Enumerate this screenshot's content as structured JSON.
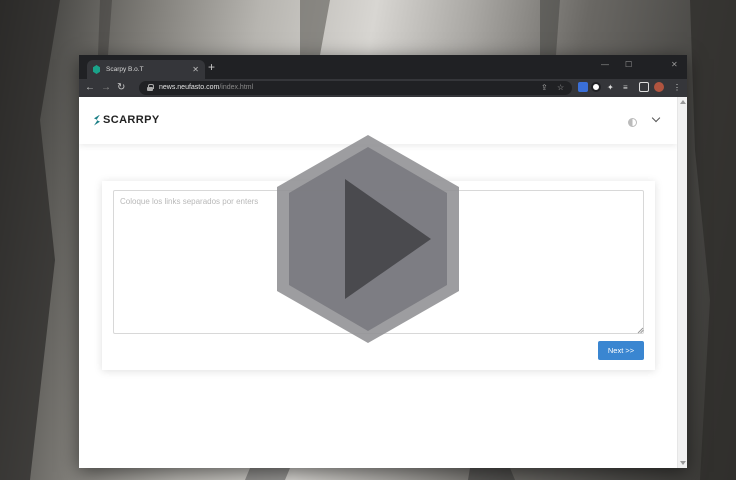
{
  "browser": {
    "tab_title": "Scarpy B.o.T",
    "tab_close": "✕",
    "new_tab": "+",
    "window_controls": {
      "minimize": "—",
      "maximize": "☐",
      "close": "✕"
    },
    "nav": {
      "back": "←",
      "forward": "→",
      "reload": "↻"
    },
    "url_domain": "news.neufasto.com",
    "url_path": "/index.html",
    "toolbar_icons": [
      "share-icon",
      "star-icon",
      "extension-icon",
      "puzzle-icon",
      "reading-list-icon",
      "side-panel-icon",
      "profile-avatar",
      "menu-icon"
    ],
    "colors": {
      "titlebar": "#202124",
      "toolbar": "#35363a"
    }
  },
  "site": {
    "logo_text": "SCARRPY",
    "colors": {
      "logo_mark": "#1b7f86",
      "primary_button": "#3a86d1"
    }
  },
  "form": {
    "links_placeholder": "Coloque los links separados por enters",
    "links_value": "",
    "next_label": "Next >>"
  },
  "overlay": {
    "icon": "play-icon"
  }
}
